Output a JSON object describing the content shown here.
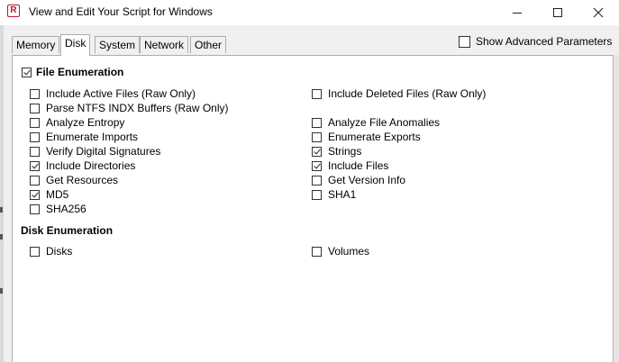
{
  "window": {
    "title": "View and Edit Your Script for Windows",
    "icon_letter": "R"
  },
  "tabs": [
    {
      "label": "Memory",
      "active": false
    },
    {
      "label": "Disk",
      "active": true
    },
    {
      "label": "System",
      "active": false
    },
    {
      "label": "Network",
      "active": false
    },
    {
      "label": "Other",
      "active": false
    }
  ],
  "advanced": {
    "label": "Show Advanced Parameters",
    "checked": false
  },
  "file_enumeration": {
    "label": "File Enumeration",
    "checked": true,
    "options": [
      {
        "label": "Include Active Files (Raw Only)",
        "checked": false
      },
      {
        "label": "Include Deleted Files (Raw Only)",
        "checked": false
      },
      {
        "label": "Parse NTFS INDX Buffers (Raw Only)",
        "checked": false
      },
      {
        "label": "Analyze Entropy",
        "checked": false
      },
      {
        "label": "Analyze File Anomalies",
        "checked": false
      },
      {
        "label": "Enumerate Imports",
        "checked": false
      },
      {
        "label": "Enumerate Exports",
        "checked": false
      },
      {
        "label": "Verify Digital Signatures",
        "checked": false
      },
      {
        "label": "Strings",
        "checked": true
      },
      {
        "label": "Include Directories",
        "checked": true
      },
      {
        "label": "Include Files",
        "checked": true
      },
      {
        "label": "Get Resources",
        "checked": false
      },
      {
        "label": "Get Version Info",
        "checked": false
      },
      {
        "label": "MD5",
        "checked": true
      },
      {
        "label": "SHA1",
        "checked": false
      },
      {
        "label": "SHA256",
        "checked": false
      }
    ]
  },
  "disk_enumeration": {
    "label": "Disk Enumeration",
    "options": [
      {
        "label": "Disks",
        "checked": false
      },
      {
        "label": "Volumes",
        "checked": false
      }
    ]
  }
}
